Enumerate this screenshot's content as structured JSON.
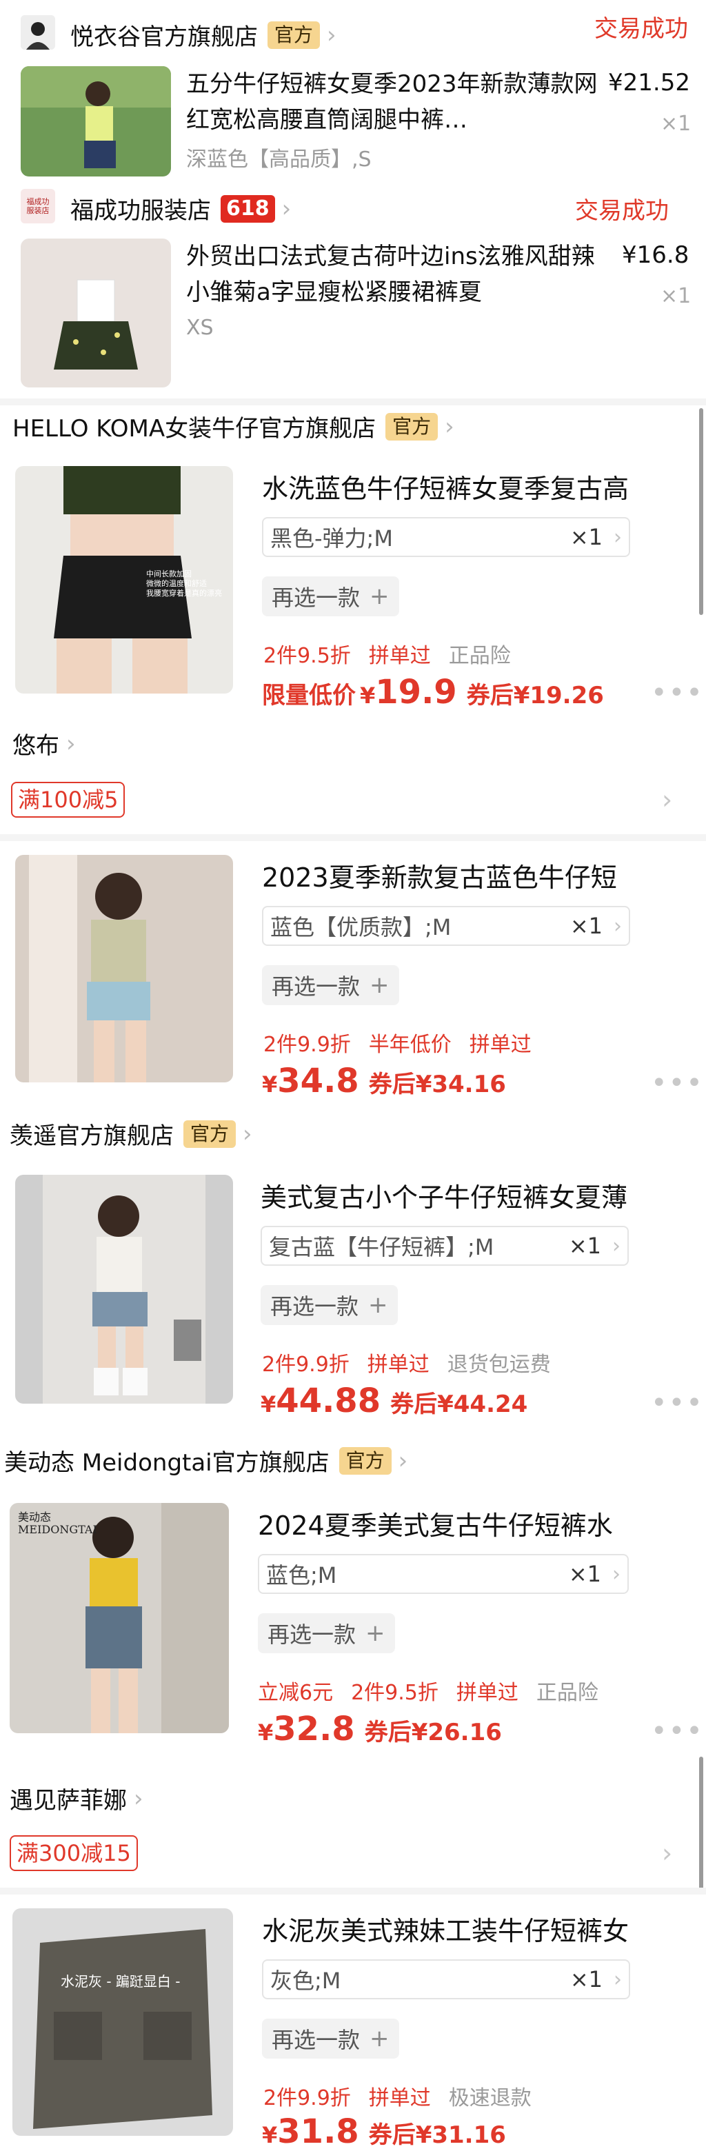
{
  "stores": [
    {
      "name": "悦衣谷官方旗舰店",
      "badge": "官方",
      "status": "交易成功"
    },
    {
      "name": "福成功服装店",
      "badge": "618",
      "status": "交易成功",
      "logo_text": "福成功\n服装店"
    },
    {
      "name": "HELLO KOMA女装牛仔官方旗舰店",
      "badge": "官方"
    },
    {
      "name": "悠布"
    },
    {
      "name": "羡遥官方旗舰店",
      "badge": "官方"
    },
    {
      "name": "美动态 Meidongtai官方旗舰店",
      "badge": "官方"
    },
    {
      "name": "遇见萨菲娜"
    }
  ],
  "orders": [
    {
      "title": "五分牛仔短裤女夏季2023年新款薄款网红宽松高腰直筒阔腿中裤…",
      "spec": "深蓝色【高品质】,S",
      "price": "¥21.52",
      "qty": "×1"
    },
    {
      "title": "外贸出口法式复古荷叶边ins泫雅风甜辣小雏菊a字显瘦松紧腰裙裤夏",
      "spec": "XS",
      "price": "¥16.8",
      "qty": "×1"
    }
  ],
  "cart_items": [
    {
      "title": "水洗蓝色牛仔短裤女夏季复古高",
      "spec": "黑色-弹力;M",
      "qty": "×1",
      "reselect": "再选一款",
      "tags": [
        {
          "text": "2件9.5折",
          "kind": "red"
        },
        {
          "text": "拼单过",
          "kind": "red"
        },
        {
          "text": "正品险",
          "kind": "gray"
        }
      ],
      "price_label": "限量低价",
      "price": "19.9",
      "after": "券后¥19.26",
      "overlay": "中间长款加固\n微微的温度和舒适\n我腰宽穿着是真的漂亮"
    },
    {
      "title": "2023夏季新款复古蓝色牛仔短",
      "spec": "蓝色【优质款】;M",
      "qty": "×1",
      "reselect": "再选一款",
      "tags": [
        {
          "text": "2件9.9折",
          "kind": "red"
        },
        {
          "text": "半年低价",
          "kind": "red"
        },
        {
          "text": "拼单过",
          "kind": "red"
        }
      ],
      "price": "34.8",
      "after": "券后¥34.16"
    },
    {
      "title": "美式复古小个子牛仔短裤女夏薄",
      "spec": "复古蓝【牛仔短裤】;M",
      "qty": "×1",
      "reselect": "再选一款",
      "tags": [
        {
          "text": "2件9.9折",
          "kind": "red"
        },
        {
          "text": "拼单过",
          "kind": "red"
        },
        {
          "text": "退货包运费",
          "kind": "gray"
        }
      ],
      "price": "44.88",
      "after": "券后¥44.24"
    },
    {
      "title": "2024夏季美式复古牛仔短裤水",
      "spec": "蓝色;M",
      "qty": "×1",
      "reselect": "再选一款",
      "tags": [
        {
          "text": "立减6元",
          "kind": "red"
        },
        {
          "text": "2件9.5折",
          "kind": "red"
        },
        {
          "text": "拼单过",
          "kind": "red"
        },
        {
          "text": "正品险",
          "kind": "gray"
        }
      ],
      "price": "32.8",
      "after": "券后¥26.16",
      "overlay": "美动态\nMEIDONGTAI"
    },
    {
      "title": "水泥灰美式辣妹工装牛仔短裤女",
      "spec": "灰色;M",
      "qty": "×1",
      "reselect": "再选一款",
      "tags": [
        {
          "text": "2件9.9折",
          "kind": "red"
        },
        {
          "text": "拼单过",
          "kind": "red"
        },
        {
          "text": "极速退款",
          "kind": "gray"
        }
      ],
      "price": "31.8",
      "after": "券后¥31.16",
      "overlay": "水泥灰 - 蹁跹显白 -"
    }
  ],
  "coupons": [
    "满100减5",
    "满300减15"
  ],
  "icons": {
    "chevron": "chevron-right-icon",
    "more": "more-dots-icon",
    "plus": "plus-icon"
  },
  "colors": {
    "accent_red": "#e0382a",
    "official_badge": "#f6d590",
    "badge_618": "#e02a20"
  }
}
